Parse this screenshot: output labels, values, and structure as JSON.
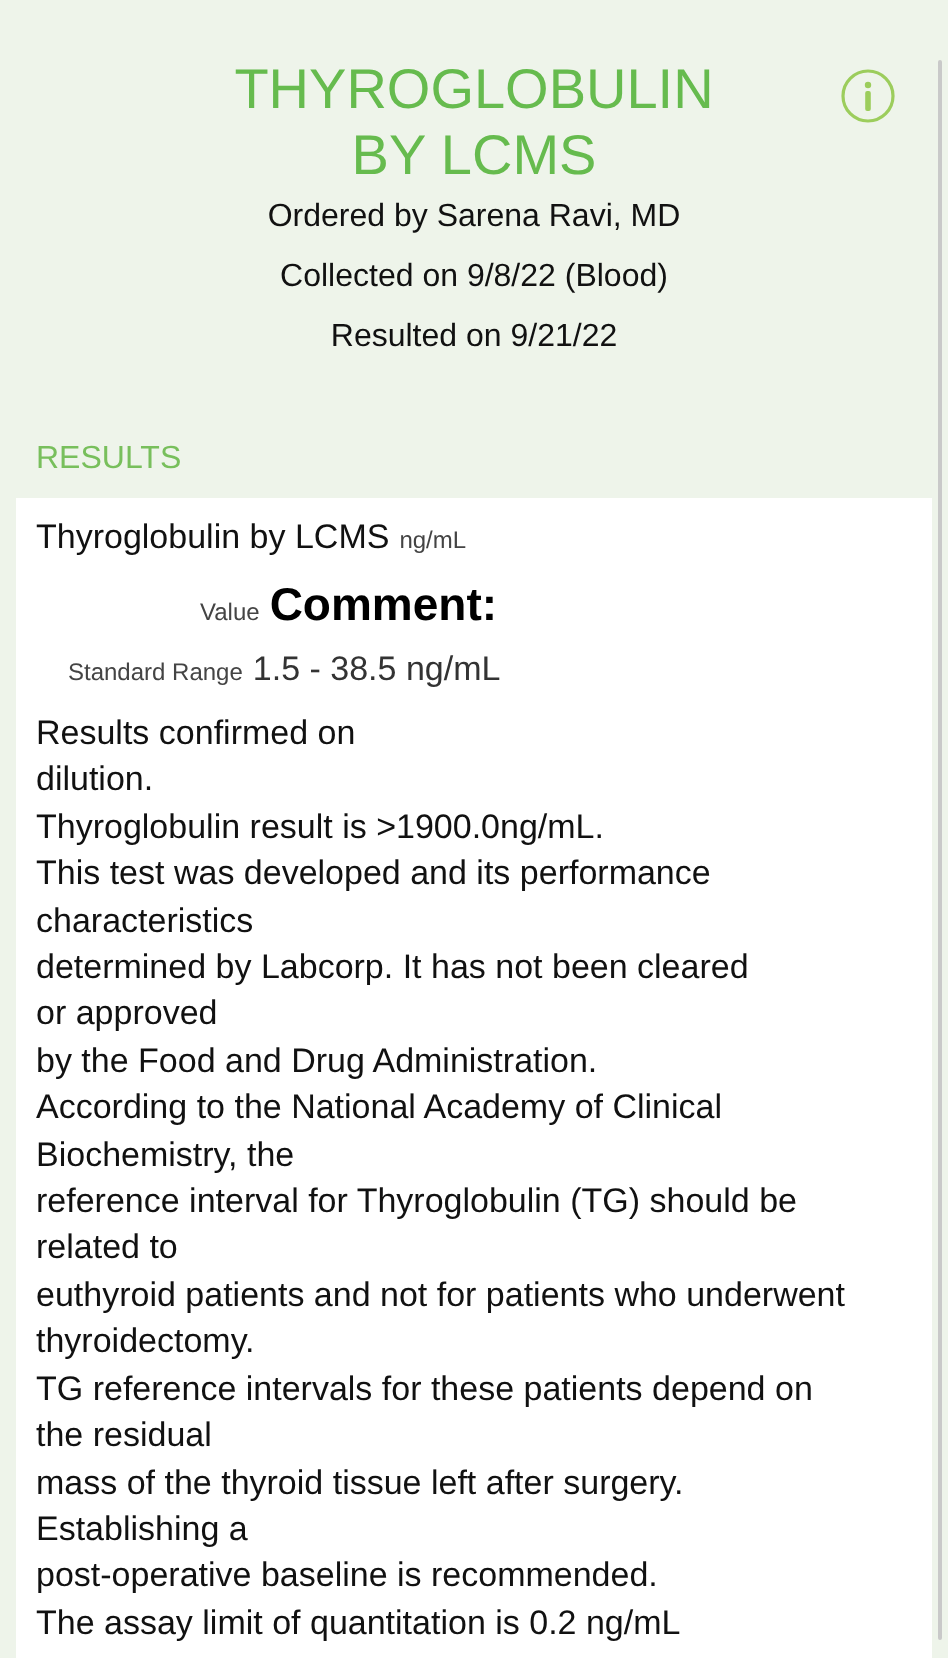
{
  "header": {
    "title": "THYROGLOBULIN BY LCMS",
    "ordered_by": "Ordered by Sarena Ravi, MD",
    "collected": "Collected on 9/8/22 (Blood)",
    "resulted": "Resulted on 9/21/22"
  },
  "section_label": "RESULTS",
  "result": {
    "name": "Thyroglobulin by LCMS",
    "unit": "ng/mL",
    "value_label": "Value",
    "value": "Comment:",
    "range_label": "Standard Range",
    "range": "1.5 - 38.5 ng/mL",
    "comment_lines": [
      "Results confirmed on",
      "dilution.",
      "Thyroglobulin result is >1900.0ng/mL.",
      "This test was developed and its performance",
      "characteristics",
      "determined by Labcorp. It has not been cleared",
      "or approved",
      "by the Food and Drug Administration.",
      "According to the National Academy of Clinical",
      "Biochemistry, the",
      "reference interval for Thyroglobulin (TG) should be",
      "related to",
      "euthyroid patients and not for patients who underwent",
      "thyroidectomy.",
      "TG reference intervals for these patients depend on",
      "the residual",
      "mass of the thyroid tissue left after surgery.",
      "Establishing a",
      "post-operative baseline is recommended.",
      "The assay limit of quantitation is 0.2 ng/mL"
    ]
  }
}
